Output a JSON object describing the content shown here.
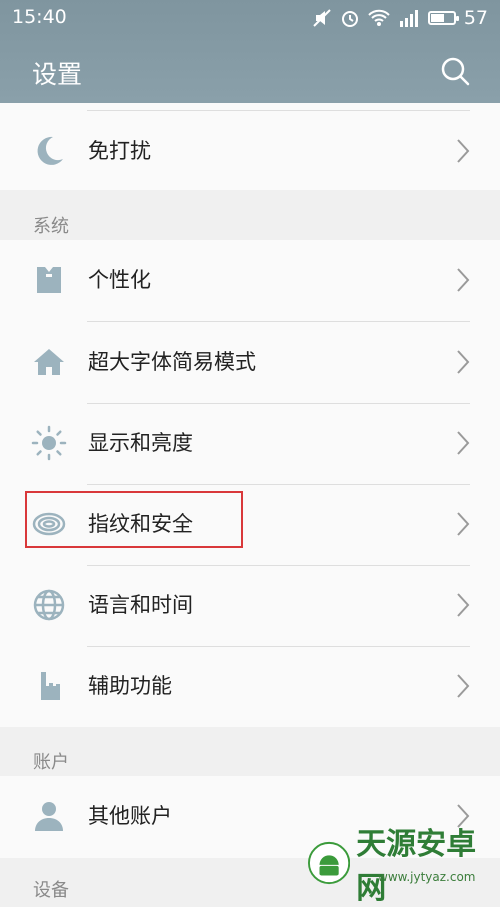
{
  "status_bar": {
    "time": "15:40",
    "battery": "57",
    "battery_level": 0.57
  },
  "header": {
    "title": "设置"
  },
  "rows": {
    "dnd": "免打扰",
    "personalize": "个性化",
    "large_font": "超大字体简易模式",
    "display": "显示和亮度",
    "fingerprint": "指纹和安全",
    "language": "语言和时间",
    "accessibility": "辅助功能",
    "other_accounts": "其他账户"
  },
  "sections": {
    "system": "系统",
    "account": "账户",
    "device": "设备"
  },
  "watermark": {
    "name": "天源安卓网",
    "url": "www.jytyaz.com"
  },
  "colors": {
    "header": "#8a9ea8",
    "icon": "#9cb3be",
    "highlight": "#d9383a"
  }
}
